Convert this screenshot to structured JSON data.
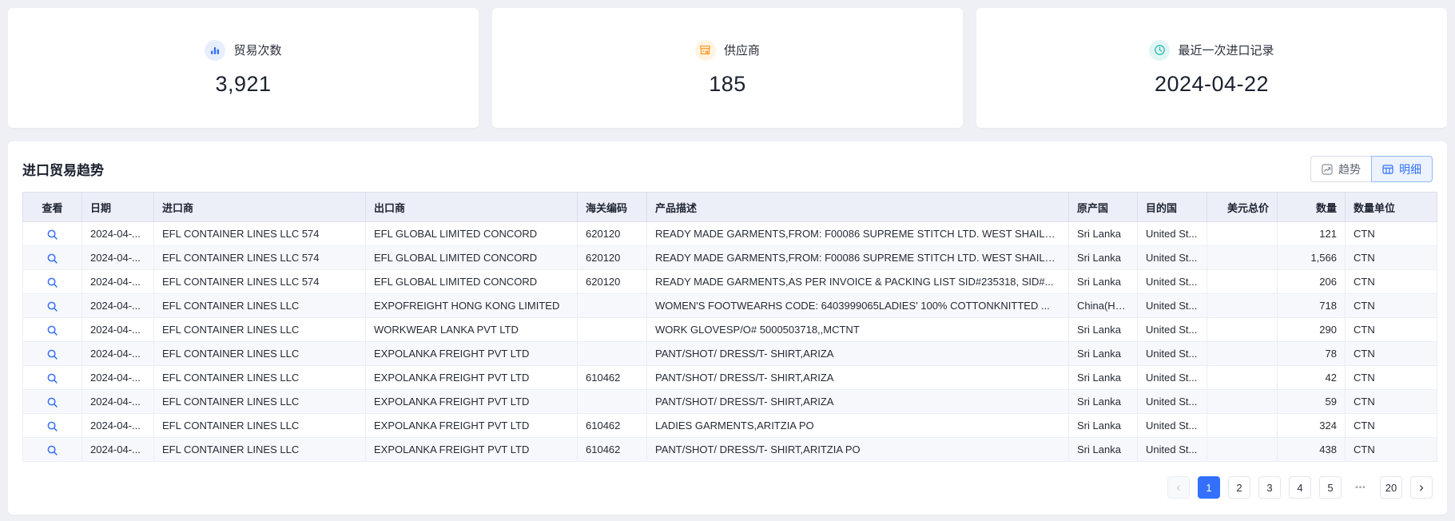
{
  "colors": {
    "accent": "#3370ff",
    "supplier_orange": "#ff9b27",
    "record_teal": "#2cb8b3"
  },
  "cards": [
    {
      "icon": "bar-chart-icon",
      "label": "贸易次数",
      "value": "3,921"
    },
    {
      "icon": "store-icon",
      "label": "供应商",
      "value": "185"
    },
    {
      "icon": "clock-icon",
      "label": "最近一次进口记录",
      "value": "2024-04-22"
    }
  ],
  "panel": {
    "title": "进口贸易趋势",
    "view_toggle": [
      {
        "label": "趋势",
        "icon": "trend-chart-icon",
        "active": false
      },
      {
        "label": "明细",
        "icon": "table-grid-icon",
        "active": true
      }
    ]
  },
  "table": {
    "columns": [
      "查看",
      "日期",
      "进口商",
      "出口商",
      "海关编码",
      "产品描述",
      "原产国",
      "目的国",
      "美元总价",
      "数量",
      "数量单位"
    ],
    "view_icon": "magnifier-icon",
    "rows": [
      {
        "date": "2024-04-...",
        "importer": "EFL CONTAINER LINES LLC 574",
        "exporter": "EFL GLOBAL LIMITED CONCORD",
        "hs_code": "620120",
        "description": "READY MADE GARMENTS,FROM: F00086 SUPREME STITCH LTD. WEST SHAILD...",
        "origin": "Sri Lanka",
        "destination": "United St...",
        "usd_total": "",
        "quantity": "121",
        "unit": "CTN"
      },
      {
        "date": "2024-04-...",
        "importer": "EFL CONTAINER LINES LLC 574",
        "exporter": "EFL GLOBAL LIMITED CONCORD",
        "hs_code": "620120",
        "description": "READY MADE GARMENTS,FROM: F00086 SUPREME STITCH LTD. WEST SHAILD...",
        "origin": "Sri Lanka",
        "destination": "United St...",
        "usd_total": "",
        "quantity": "1,566",
        "unit": "CTN"
      },
      {
        "date": "2024-04-...",
        "importer": "EFL CONTAINER LINES LLC 574",
        "exporter": "EFL GLOBAL LIMITED CONCORD",
        "hs_code": "620120",
        "description": "READY MADE GARMENTS,AS PER INVOICE & PACKING LIST SID#235318, SID#...",
        "origin": "Sri Lanka",
        "destination": "United St...",
        "usd_total": "",
        "quantity": "206",
        "unit": "CTN"
      },
      {
        "date": "2024-04-...",
        "importer": "EFL CONTAINER LINES LLC",
        "exporter": "EXPOFREIGHT HONG KONG LIMITED",
        "hs_code": "",
        "description": "WOMEN'S FOOTWEARHS CODE: 6403999065LADIES' 100% COTTONKNITTED ...",
        "origin": "China(Ho...",
        "destination": "United St...",
        "usd_total": "",
        "quantity": "718",
        "unit": "CTN"
      },
      {
        "date": "2024-04-...",
        "importer": "EFL CONTAINER LINES LLC",
        "exporter": "WORKWEAR LANKA PVT LTD",
        "hs_code": "",
        "description": "WORK GLOVESP/O# 5000503718,,MCTNT",
        "origin": "Sri Lanka",
        "destination": "United St...",
        "usd_total": "",
        "quantity": "290",
        "unit": "CTN"
      },
      {
        "date": "2024-04-...",
        "importer": "EFL CONTAINER LINES LLC",
        "exporter": "EXPOLANKA FREIGHT PVT LTD",
        "hs_code": "",
        "description": "PANT/SHOT/ DRESS/T- SHIRT,ARIZA",
        "origin": "Sri Lanka",
        "destination": "United St...",
        "usd_total": "",
        "quantity": "78",
        "unit": "CTN"
      },
      {
        "date": "2024-04-...",
        "importer": "EFL CONTAINER LINES LLC",
        "exporter": "EXPOLANKA FREIGHT PVT LTD",
        "hs_code": "610462",
        "description": "PANT/SHOT/ DRESS/T- SHIRT,ARIZA",
        "origin": "Sri Lanka",
        "destination": "United St...",
        "usd_total": "",
        "quantity": "42",
        "unit": "CTN"
      },
      {
        "date": "2024-04-...",
        "importer": "EFL CONTAINER LINES LLC",
        "exporter": "EXPOLANKA FREIGHT PVT LTD",
        "hs_code": "",
        "description": "PANT/SHOT/ DRESS/T- SHIRT,ARIZA",
        "origin": "Sri Lanka",
        "destination": "United St...",
        "usd_total": "",
        "quantity": "59",
        "unit": "CTN"
      },
      {
        "date": "2024-04-...",
        "importer": "EFL CONTAINER LINES LLC",
        "exporter": "EXPOLANKA FREIGHT PVT LTD",
        "hs_code": "610462",
        "description": "LADIES GARMENTS,ARITZIA PO",
        "origin": "Sri Lanka",
        "destination": "United St...",
        "usd_total": "",
        "quantity": "324",
        "unit": "CTN"
      },
      {
        "date": "2024-04-...",
        "importer": "EFL CONTAINER LINES LLC",
        "exporter": "EXPOLANKA FREIGHT PVT LTD",
        "hs_code": "610462",
        "description": "PANT/SHOT/ DRESS/T- SHIRT,ARITZIA PO",
        "origin": "Sri Lanka",
        "destination": "United St...",
        "usd_total": "",
        "quantity": "438",
        "unit": "CTN"
      }
    ]
  },
  "pagination": {
    "prev": "‹",
    "pages": [
      "1",
      "2",
      "3",
      "4",
      "5"
    ],
    "active_page": "1",
    "ellipsis": "•••",
    "last_page": "20",
    "next": "›"
  }
}
